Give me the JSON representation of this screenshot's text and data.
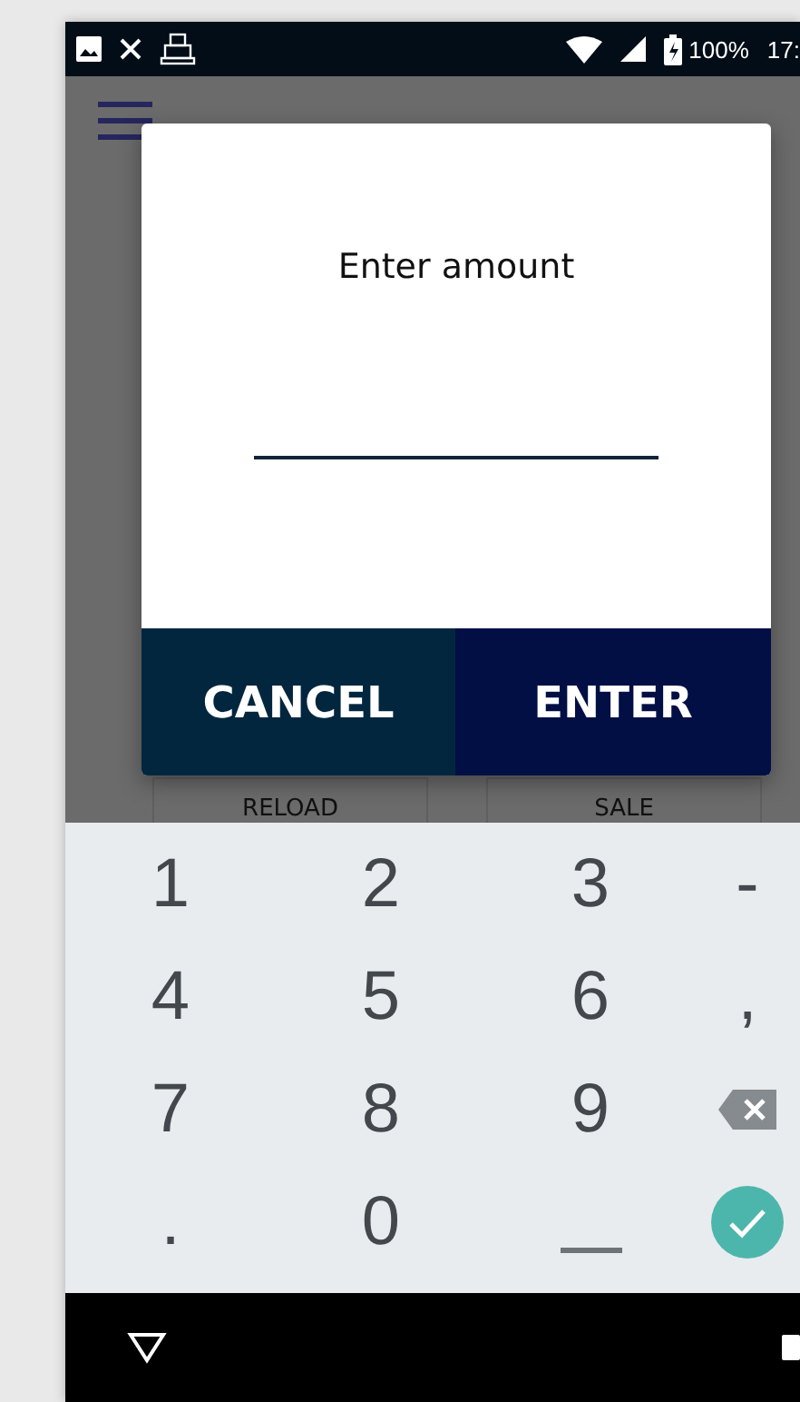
{
  "status_bar": {
    "battery": "100%",
    "time": "17:"
  },
  "background": {
    "cards": [
      "RELOAD",
      "SALE"
    ]
  },
  "dialog": {
    "title": "Enter amount",
    "buttons": [
      {
        "label": "CANCEL",
        "kind": "cancel"
      },
      {
        "label": "ENTER",
        "kind": "confirm"
      }
    ]
  },
  "keypad": {
    "rows": [
      [
        {
          "kind": "char",
          "label": "1"
        },
        {
          "kind": "char",
          "label": "2"
        },
        {
          "kind": "char",
          "label": "3"
        },
        {
          "kind": "char",
          "label": "-"
        }
      ],
      [
        {
          "kind": "char",
          "label": "4"
        },
        {
          "kind": "char",
          "label": "5"
        },
        {
          "kind": "char",
          "label": "6"
        },
        {
          "kind": "char",
          "label": ","
        }
      ],
      [
        {
          "kind": "char",
          "label": "7"
        },
        {
          "kind": "char",
          "label": "8"
        },
        {
          "kind": "char",
          "label": "9"
        },
        {
          "kind": "backspace"
        }
      ],
      [
        {
          "kind": "char",
          "label": "."
        },
        {
          "kind": "char",
          "label": "0"
        },
        {
          "kind": "space"
        },
        {
          "kind": "done"
        }
      ]
    ]
  }
}
